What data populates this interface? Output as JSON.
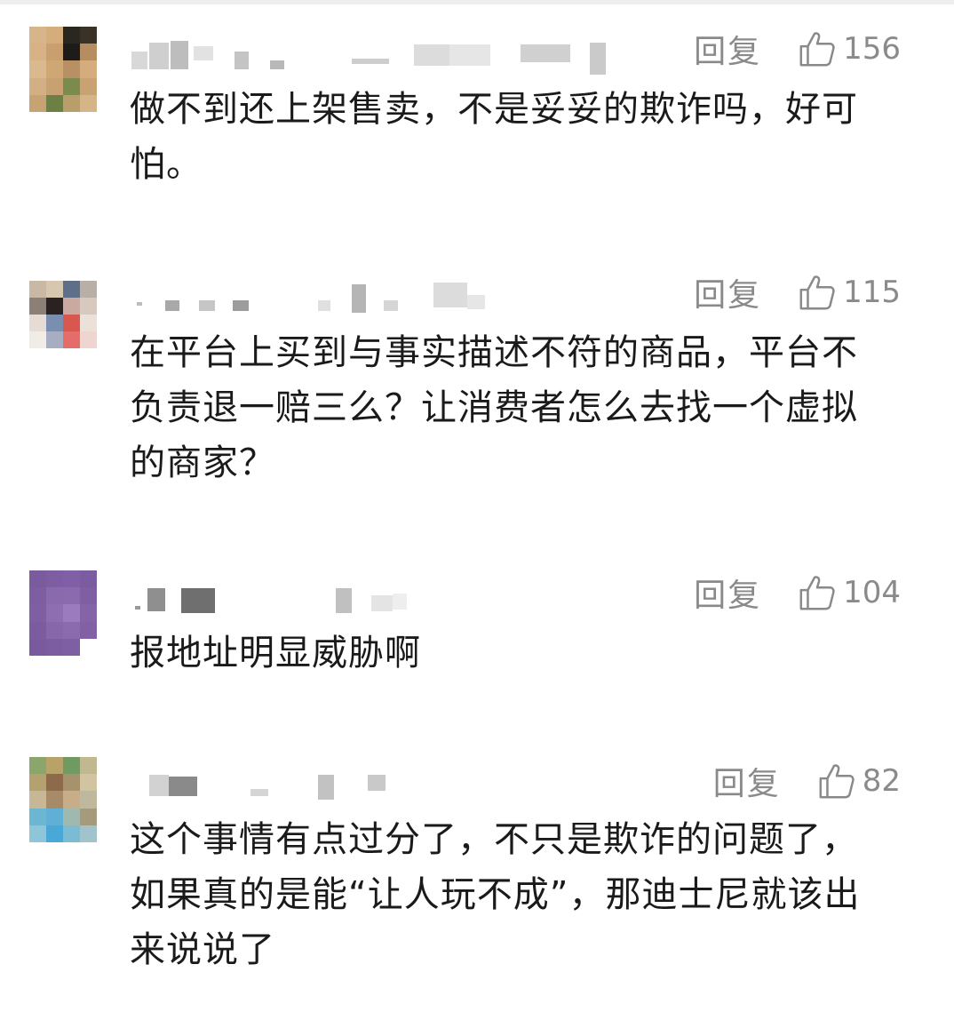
{
  "comments": [
    {
      "reply_label": "回复",
      "likes": "156",
      "text": "做不到还上架售卖，不是妥妥的欺诈吗，好可怕。"
    },
    {
      "reply_label": "回复",
      "likes": "115",
      "text": "在平台上买到与事实描述不符的商品，平台不负责退一赔三么？让消费者怎么去找一个虚拟的商家？"
    },
    {
      "reply_label": "回复",
      "likes": "104",
      "text": "报地址明显威胁啊"
    },
    {
      "reply_label": "回复",
      "likes": "82",
      "text": "这个事情有点过分了，不只是欺诈的问题了，如果真的是能“让人玩不成”，那迪士尼就该出来说说了"
    }
  ],
  "icons": {
    "like": "thumbs-up-icon"
  },
  "colors": {
    "meta_text": "#8a8a8a",
    "body_text": "#1a1a1a"
  }
}
